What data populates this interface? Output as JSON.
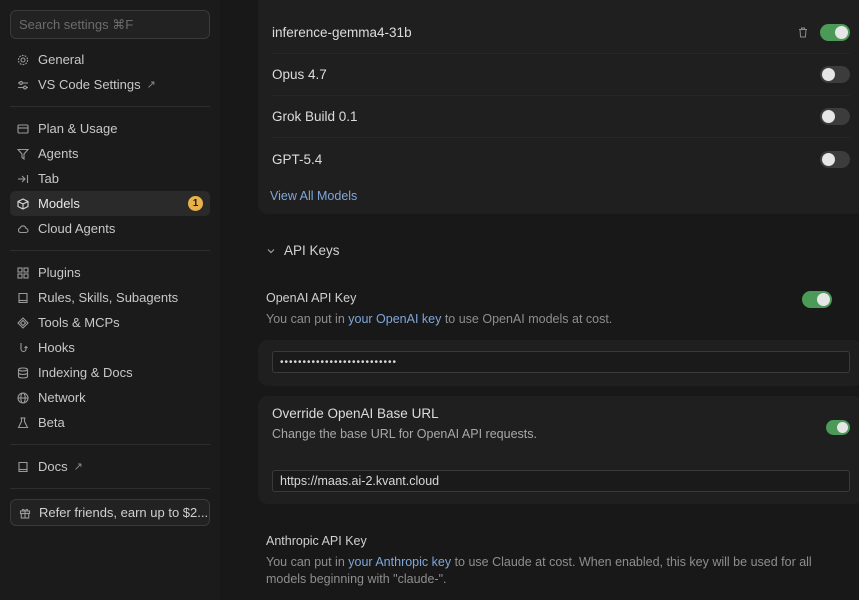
{
  "sidebar": {
    "search_placeholder": "Search settings ⌘F",
    "group1": [
      {
        "label": "General",
        "icon": "gear-icon"
      },
      {
        "label": "VS Code Settings",
        "icon": "sliders-icon",
        "external": "↗"
      }
    ],
    "group2": [
      {
        "label": "Plan & Usage",
        "icon": "card-icon"
      },
      {
        "label": "Agents",
        "icon": "agent-icon"
      },
      {
        "label": "Tab",
        "icon": "tab-arrow-icon"
      },
      {
        "label": "Models",
        "icon": "cube-icon",
        "badge": "1",
        "active": true
      },
      {
        "label": "Cloud Agents",
        "icon": "cloud-icon"
      }
    ],
    "group3": [
      {
        "label": "Plugins",
        "icon": "grid-icon"
      },
      {
        "label": "Rules, Skills, Subagents",
        "icon": "book-icon"
      },
      {
        "label": "Tools & MCPs",
        "icon": "tools-icon"
      },
      {
        "label": "Hooks",
        "icon": "hook-icon"
      },
      {
        "label": "Indexing & Docs",
        "icon": "database-icon"
      },
      {
        "label": "Network",
        "icon": "globe-icon"
      },
      {
        "label": "Beta",
        "icon": "flask-icon"
      }
    ],
    "group4": [
      {
        "label": "Docs",
        "icon": "book-icon",
        "external": "↗"
      }
    ],
    "refer_label": "Refer friends, earn up to $2..."
  },
  "models": {
    "rows": [
      {
        "name": "inference-gemma4-31b",
        "enabled": true,
        "deletable": true
      },
      {
        "name": "Opus 4.7",
        "enabled": false
      },
      {
        "name": "Grok Build 0.1",
        "enabled": false
      },
      {
        "name": "GPT-5.4",
        "enabled": false
      }
    ],
    "view_all": "View All Models"
  },
  "api_keys": {
    "section_title": "API Keys",
    "openai": {
      "title": "OpenAI API Key",
      "desc_prefix": "You can put in ",
      "desc_link": "your OpenAI key",
      "desc_suffix": " to use OpenAI models at cost.",
      "enabled": true,
      "value": "••••••••••••••••••••••••••"
    },
    "override": {
      "title": "Override OpenAI Base URL",
      "desc": "Change the base URL for OpenAI API requests.",
      "enabled": true,
      "value": "https://maas.ai-2.kvant.cloud"
    },
    "anthropic": {
      "title": "Anthropic API Key",
      "desc_prefix": "You can put in ",
      "desc_link": "your Anthropic key",
      "desc_suffix": " to use Claude at cost. When enabled, this key will be used for all models beginning with \"claude-\"."
    }
  },
  "colors": {
    "accent_green": "#4c9a58",
    "link_blue": "#7fa7d9",
    "badge_orange": "#e8b24a"
  }
}
